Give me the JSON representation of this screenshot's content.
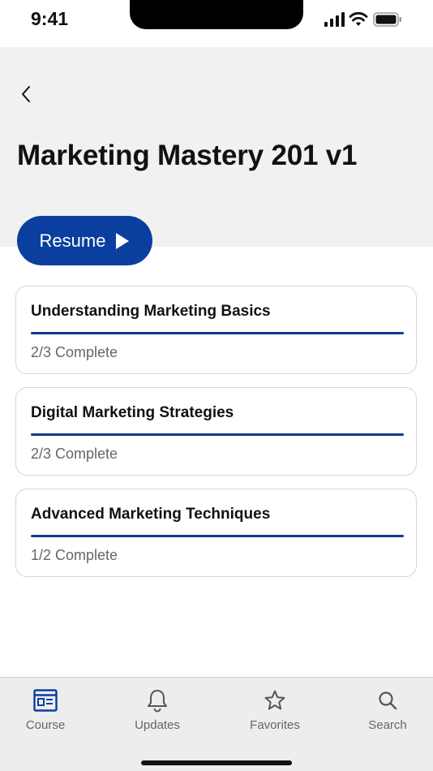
{
  "status_bar": {
    "time": "9:41"
  },
  "header": {
    "title": "Marketing Mastery 201 v1"
  },
  "resume_button": {
    "label": "Resume"
  },
  "modules": [
    {
      "title": "Understanding Marketing Basics",
      "progress_text": "2/3 Complete",
      "progress_fraction": 1.0
    },
    {
      "title": "Digital Marketing Strategies",
      "progress_text": "2/3 Complete",
      "progress_fraction": 1.0
    },
    {
      "title": "Advanced Marketing Techniques",
      "progress_text": "1/2 Complete",
      "progress_fraction": 1.0
    }
  ],
  "tab_bar": {
    "tabs": [
      {
        "label": "Course",
        "icon": "course-icon",
        "active": true
      },
      {
        "label": "Updates",
        "icon": "bell-icon",
        "active": false
      },
      {
        "label": "Favorites",
        "icon": "star-icon",
        "active": false
      },
      {
        "label": "Search",
        "icon": "search-icon",
        "active": false
      }
    ]
  },
  "colors": {
    "accent": "#0a3fa0",
    "progress": "#0d3b8c",
    "header_bg": "#f1f1f1",
    "tab_bar_bg": "#ededed"
  }
}
